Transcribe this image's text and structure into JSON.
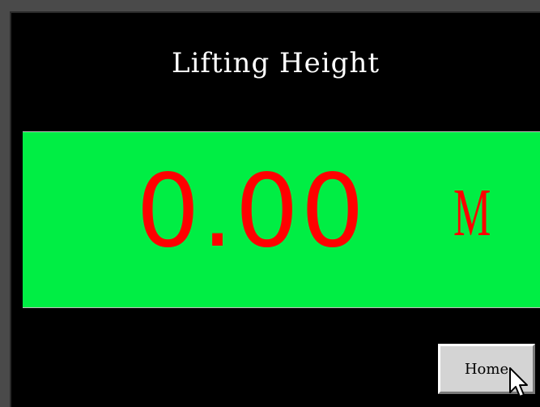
{
  "screen": {
    "title": "Lifting Height",
    "height_value": "0.00",
    "unit": "M",
    "home_label": "Home"
  },
  "colors": {
    "background": "#000000",
    "panel": "#00ee44",
    "value_text": "#ff0000",
    "title_text": "#ffffff"
  },
  "icons": {
    "cursor": "mouse-pointer-icon"
  }
}
